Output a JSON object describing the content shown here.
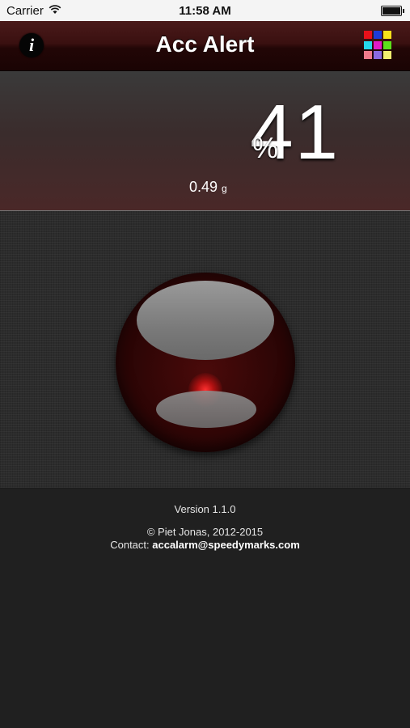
{
  "status_bar": {
    "carrier": "Carrier",
    "time": "11:58 AM",
    "icons": [
      "wifi-icon",
      "battery-icon"
    ]
  },
  "nav": {
    "title": "Acc Alert",
    "info_label": "i",
    "color_grid_colors": [
      "#e8101a",
      "#1d3bd8",
      "#f5e21a",
      "#25d8ea",
      "#e01ac8",
      "#5ce01a",
      "#f07a8a",
      "#8a6ae0",
      "#f0f070"
    ]
  },
  "reading": {
    "percent_value": "41",
    "percent_unit": "%",
    "g_value": "0.49",
    "g_unit": "g"
  },
  "level": {
    "accent_color": "#ff2020"
  },
  "footer": {
    "version": "Version 1.1.0",
    "copyright": "© Piet Jonas, 2012-2015",
    "contact_label": "Contact: ",
    "contact_email": "accalarm@speedymarks.com"
  }
}
